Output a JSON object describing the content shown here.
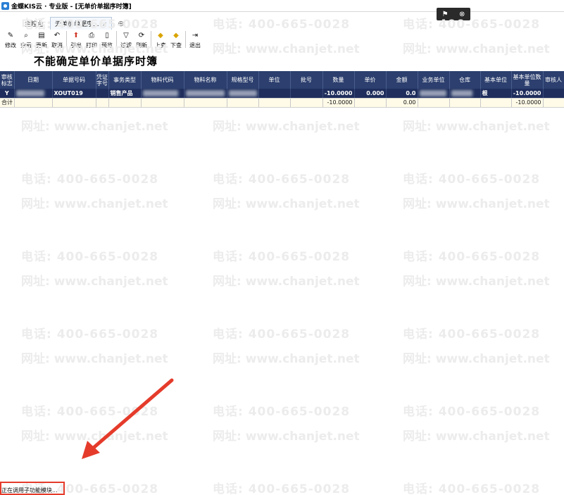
{
  "window": {
    "title": "金蝶KIS云 · 专业版 - [无单价单据序时簿]"
  },
  "float_controls": {
    "pin_icon": "pin-icon",
    "close_icon": "close-icon"
  },
  "tabs": [
    {
      "label": "主控台"
    },
    {
      "label": "无单价单据序..."
    }
  ],
  "toolbar": {
    "items": [
      {
        "label": "修改",
        "icon": "✎"
      },
      {
        "label": "查看",
        "icon": "⌕"
      },
      {
        "label": "更新",
        "icon": "▤"
      },
      {
        "label": "取消",
        "icon": "↶"
      },
      {
        "label": "引出",
        "icon": "⬆"
      },
      {
        "label": "打印",
        "icon": "⎙"
      },
      {
        "label": "预览",
        "icon": "▯"
      },
      {
        "label": "过滤",
        "icon": "▽"
      },
      {
        "label": "刷新",
        "icon": "⟳"
      },
      {
        "label": "上查",
        "icon": "◆"
      },
      {
        "label": "下查",
        "icon": "◆"
      },
      {
        "label": "退出",
        "icon": "⇥"
      }
    ]
  },
  "page_title": "不能确定单价单据序时簿",
  "grid": {
    "columns": [
      "审核标志",
      "日期",
      "单据号码",
      "凭证字号",
      "事务类型",
      "物料代码",
      "物料名称",
      "规格型号",
      "单位",
      "批号",
      "数量",
      "单价",
      "金额",
      "业务单位",
      "仓库",
      "基本单位",
      "基本单位数量",
      "审核人"
    ],
    "row": {
      "flag": "Y",
      "doc_no": "XOUT019",
      "type": "销售产品",
      "qty": "-10.0000",
      "price": "0.000",
      "amount": "0.0",
      "base_unit": "根",
      "base_qty": "-10.0000"
    },
    "total": {
      "label": "合计",
      "qty": "-10.0000",
      "amount": "0.00",
      "base_qty": "-10.0000"
    }
  },
  "watermark": {
    "phone": "电话: 400-665-0028",
    "site": "网址: www.chanjet.net"
  },
  "status": "正在调用子功能模块...",
  "colors": {
    "header": "#2c3f6e",
    "selected_row": "#1f2e5c",
    "total_row": "#fffbe8",
    "annotation": "#e53b2b"
  }
}
